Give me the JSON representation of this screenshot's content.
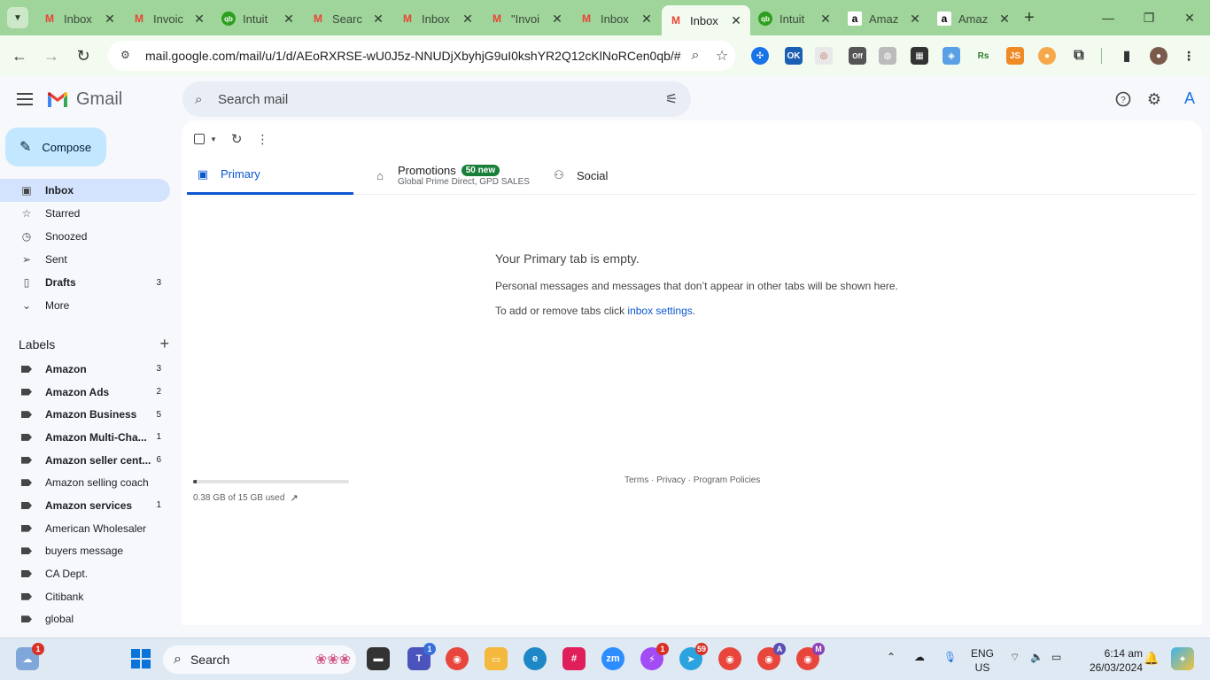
{
  "browser": {
    "tabs": [
      {
        "title": "Inbox",
        "icon": "gmail"
      },
      {
        "title": "Invoic",
        "icon": "gmail"
      },
      {
        "title": "Intuit",
        "icon": "quickbooks"
      },
      {
        "title": "Searc",
        "icon": "gmail"
      },
      {
        "title": "Inbox",
        "icon": "gmail"
      },
      {
        "title": "\"Invoi",
        "icon": "gmail"
      },
      {
        "title": "Inbox",
        "icon": "gmail"
      },
      {
        "title": "Inbox",
        "icon": "gmail"
      },
      {
        "title": "Intuit",
        "icon": "quickbooks"
      },
      {
        "title": "Amaz",
        "icon": "amazon"
      },
      {
        "title": "Amaz",
        "icon": "amazon"
      }
    ],
    "active_tab": 7,
    "url": "mail.google.com/mail/u/1/d/AEoRXRSE-wU0J5z-NNUDjXbyhjG9uI0kshYR2Q12cKlNoRCen0qb/#...",
    "extension_badges": {
      "ok": "OK",
      "off": "Off",
      "rs": "Rs",
      "js": "JS"
    }
  },
  "gmail": {
    "logo_text": "Gmail",
    "search_placeholder": "Search mail",
    "avatar_letter": "A",
    "compose_label": "Compose",
    "nav": [
      {
        "label": "Inbox",
        "count": "",
        "icon": "inbox-icon"
      },
      {
        "label": "Starred",
        "count": "",
        "icon": "star-icon"
      },
      {
        "label": "Snoozed",
        "count": "",
        "icon": "clock-icon"
      },
      {
        "label": "Sent",
        "count": "",
        "icon": "send-icon"
      },
      {
        "label": "Drafts",
        "count": "3",
        "icon": "draft-icon"
      },
      {
        "label": "More",
        "count": "",
        "icon": "chevron-down-icon"
      }
    ],
    "labels_title": "Labels",
    "labels": [
      {
        "label": "Amazon",
        "count": "3",
        "bold": true
      },
      {
        "label": "Amazon Ads",
        "count": "2",
        "bold": true
      },
      {
        "label": "Amazon Business",
        "count": "5",
        "bold": true
      },
      {
        "label": "Amazon Multi-Cha...",
        "count": "1",
        "bold": true
      },
      {
        "label": "Amazon seller cent...",
        "count": "6",
        "bold": true
      },
      {
        "label": "Amazon selling coach",
        "count": "",
        "bold": false
      },
      {
        "label": "Amazon services",
        "count": "1",
        "bold": true
      },
      {
        "label": "American Wholesaler",
        "count": "",
        "bold": false
      },
      {
        "label": "buyers message",
        "count": "",
        "bold": false
      },
      {
        "label": "CA Dept.",
        "count": "",
        "bold": false
      },
      {
        "label": "Citibank",
        "count": "",
        "bold": false
      },
      {
        "label": "global",
        "count": "",
        "bold": false
      }
    ],
    "tabs": {
      "primary": "Primary",
      "promotions": "Promotions",
      "promotions_badge": "50 new",
      "promotions_sub": "Global Prime Direct, GPD SALES",
      "social": "Social"
    },
    "empty": {
      "heading": "Your Primary tab is empty.",
      "line1": "Personal messages and messages that don’t appear in other tabs will be shown here.",
      "line2_prefix": "To add or remove tabs click ",
      "line2_link": "inbox settings",
      "line2_suffix": "."
    },
    "storage": {
      "text": "0.38 GB of 15 GB used",
      "fraction": 0.025
    },
    "footer": "Terms · Privacy · Program Policies"
  },
  "taskbar": {
    "search_label": "Search",
    "widgets_badge": "1",
    "teams_badge": "1",
    "messenger_badge": "1",
    "telegram_badge": "59",
    "lang_line1": "ENG",
    "lang_line2": "US",
    "time": "6:14 am",
    "date": "26/03/2024",
    "chrome_profile_a": "A",
    "chrome_profile_m": "M"
  },
  "colors": {
    "chrome_frame": "#9fd49a",
    "gmail_bg": "#f6f8fc",
    "compose_bg": "#c2e7ff",
    "active_nav": "#d3e3fd",
    "accent_blue": "#0b57d0",
    "badge_green": "#188038"
  }
}
